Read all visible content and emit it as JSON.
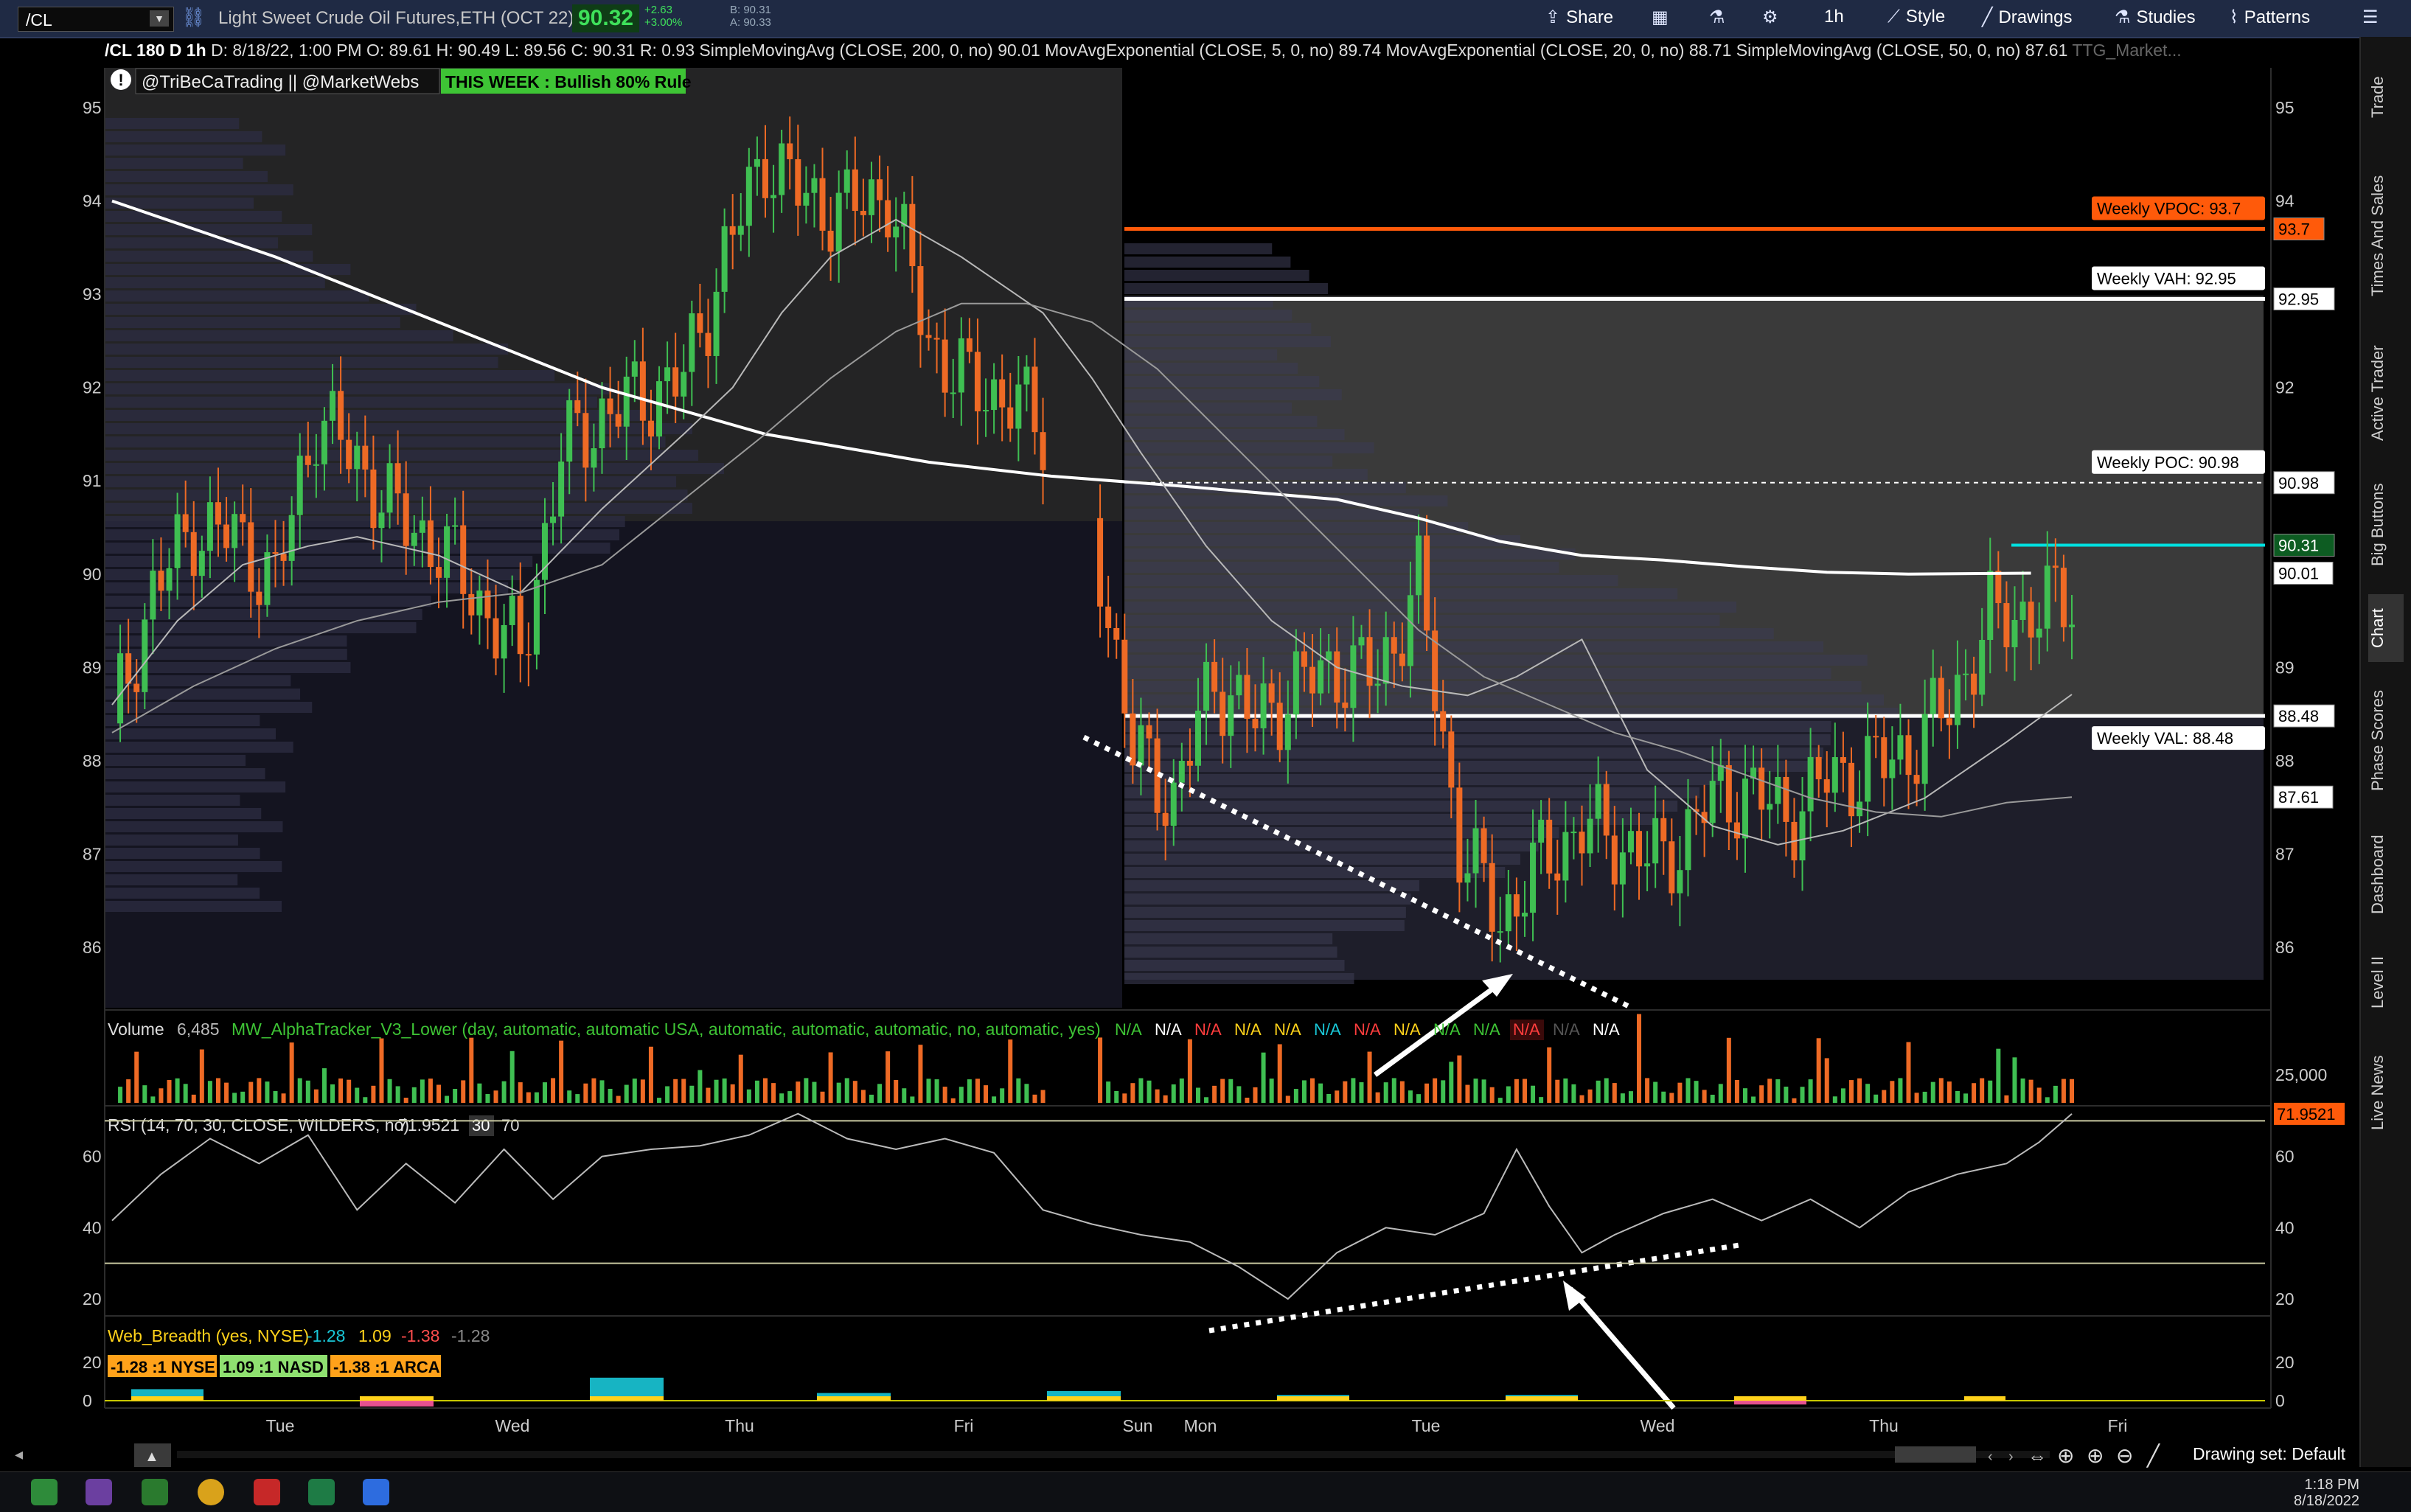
{
  "toolbar": {
    "symbol": "/CL",
    "description": "Light Sweet Crude Oil Futures,ETH (OCT 22)",
    "last": "90.32",
    "net_change": "+2.63",
    "net_change_pct": "+3.00%",
    "bid": "B: 90.31",
    "ask": "A: 90.33",
    "buttons": [
      "Share",
      "1h",
      "Style",
      "Drawings",
      "Studies",
      "Patterns"
    ]
  },
  "status": {
    "chart_title": "/CL 180 D 1h",
    "date": "D: 8/18/22, 1:00 PM",
    "open": "O: 89.61",
    "high": "H: 90.49",
    "low": "L: 89.56",
    "close": "C: 90.31",
    "range": "R: 0.93",
    "studies": [
      {
        "label": "SimpleMovingAvg (CLOSE, 200, 0, no)",
        "value": "90.01"
      },
      {
        "label": "MovAvgExponential (CLOSE, 5, 0, no)",
        "value": "89.74"
      },
      {
        "label": "MovAvgExponential (CLOSE, 20, 0, no)",
        "value": "88.71"
      },
      {
        "label": "SimpleMovingAvg (CLOSE, 50, 0, no)",
        "value": "87.61"
      }
    ],
    "extra": "TTG_Market..."
  },
  "colors": {
    "up": "#3fbf52",
    "down": "#ee6a25",
    "vpoc": "#ff5a0a",
    "value_line": "#ffffff",
    "cyan": "#00e1e1",
    "rsi": "#bbbbbb",
    "alert_bg": "#3ec435"
  },
  "chart_data": [
    {
      "type": "line",
      "panel": "price",
      "ylim": [
        85.4,
        95.5
      ],
      "y_ticks": [
        86,
        87,
        88,
        89,
        90,
        91,
        92,
        93,
        94,
        95
      ],
      "x_tick_labels": [
        "Tue",
        "Wed",
        "Thu",
        "Fri",
        "Sun",
        "Mon",
        "Tue",
        "Wed",
        "Thu",
        "Fri"
      ],
      "watermark": "@TriBeCaTrading || @MarketWebs",
      "alert": "THIS WEEK : Bullish 80% Rule",
      "series": [
        {
          "name": "SimpleMovingAvg (CLOSE, 200, 0, no)",
          "x": [
            0,
            20,
            40,
            60,
            80,
            100,
            115,
            130,
            150,
            160,
            170,
            180,
            190,
            200,
            210,
            220,
            235
          ],
          "y": [
            94.0,
            93.4,
            92.7,
            92.0,
            91.5,
            91.2,
            91.05,
            90.95,
            90.8,
            90.6,
            90.35,
            90.2,
            90.15,
            90.08,
            90.02,
            90.0,
            90.01
          ]
        },
        {
          "name": "MovAvgExponential (CLOSE, 20, 0, no)",
          "x": [
            0,
            8,
            16,
            24,
            30,
            40,
            50,
            60,
            70,
            76,
            82,
            88,
            96,
            104,
            114,
            120,
            126,
            134,
            142,
            150,
            158,
            166,
            172,
            180,
            188,
            196,
            204,
            212,
            222,
            232,
            240
          ],
          "y": [
            88.6,
            89.5,
            90.1,
            90.3,
            90.4,
            90.2,
            89.8,
            90.7,
            91.5,
            92.0,
            92.8,
            93.4,
            93.8,
            93.4,
            92.8,
            92.1,
            91.3,
            90.3,
            89.5,
            89.0,
            88.8,
            88.7,
            88.9,
            89.3,
            87.9,
            87.3,
            87.1,
            87.25,
            87.6,
            88.2,
            88.71
          ]
        },
        {
          "name": "SimpleMovingAvg (CLOSE, 50, 0, no)",
          "x": [
            0,
            10,
            20,
            30,
            40,
            50,
            60,
            70,
            80,
            88,
            96,
            104,
            112,
            120,
            128,
            136,
            144,
            152,
            160,
            168,
            176,
            184,
            192,
            200,
            208,
            216,
            224,
            232,
            240
          ],
          "y": [
            88.3,
            88.8,
            89.2,
            89.5,
            89.7,
            89.8,
            90.1,
            90.8,
            91.5,
            92.1,
            92.6,
            92.9,
            92.9,
            92.7,
            92.2,
            91.5,
            90.8,
            90.1,
            89.4,
            88.9,
            88.6,
            88.3,
            88.1,
            87.85,
            87.6,
            87.45,
            87.4,
            87.55,
            87.61
          ]
        },
        {
          "name": "MovAvgExponential (CLOSE, 5, 0, no)",
          "x": [
            0,
            5,
            10,
            15,
            20,
            25,
            30,
            35,
            40,
            45,
            50,
            55,
            60,
            65,
            70,
            75,
            80,
            85,
            90,
            95,
            100,
            105,
            110,
            115,
            120,
            125,
            130,
            135,
            140,
            145,
            150,
            155,
            160,
            165,
            170,
            175,
            180,
            185,
            190,
            195,
            200,
            205,
            210,
            215,
            220,
            225,
            230,
            235,
            240
          ],
          "y": [
            88.4,
            89.8,
            90.5,
            90.4,
            89.9,
            91.7,
            91.2,
            90.6,
            90.3,
            89.7,
            89.1,
            91.3,
            91.7,
            91.9,
            92.1,
            93.4,
            94.5,
            94.0,
            93.9,
            94.1,
            92.5,
            92.0,
            91.9,
            91.4,
            90.6,
            88.1,
            87.6,
            88.9,
            88.4,
            88.8,
            89.0,
            88.9,
            89.9,
            87.1,
            86.3,
            86.9,
            87.3,
            87.1,
            86.9,
            87.5,
            87.7,
            87.4,
            87.8,
            87.9,
            88.1,
            88.6,
            89.5,
            89.6,
            89.74
          ]
        }
      ],
      "levels": [
        {
          "label": "Weekly VPOC: 93.7",
          "value": 93.7,
          "tag": "93.7",
          "style": "vpoc"
        },
        {
          "label": "Weekly VAH: 92.95",
          "value": 92.95,
          "tag": "92.95",
          "style": "solid"
        },
        {
          "label": "Weekly POC: 90.98",
          "value": 90.98,
          "tag": "90.98",
          "style": "dashed"
        },
        {
          "label": "Weekly VAL: 88.48",
          "value": 88.48,
          "tag": "88.48",
          "style": "solid"
        },
        {
          "label": "",
          "value": 90.31,
          "tag": "90.31",
          "style": "cyan"
        }
      ],
      "right_tags": [
        {
          "value": 90.01,
          "text": "90.01"
        },
        {
          "value": 87.61,
          "text": "87.61"
        }
      ]
    },
    {
      "type": "bar",
      "panel": "volume",
      "title": "Volume",
      "current": "6,485",
      "study": "MW_AlphaTracker_V3_Lower (day, automatic, automatic USA, automatic, automatic, automatic, no, automatic, yes)",
      "na_labels": [
        "N/A",
        "N/A",
        "N/A",
        "N/A",
        "N/A",
        "N/A",
        "N/A",
        "N/A",
        "N/A",
        "N/A",
        "N/A",
        "N/A",
        "N/A"
      ],
      "ylim": [
        0,
        36000
      ],
      "y_ticks": [
        25000
      ],
      "y_tick_labels": [
        "25,000"
      ]
    },
    {
      "type": "line",
      "panel": "rsi",
      "title": "RSI (14, 70, 30, CLOSE, WILDERS, no)",
      "value": "71.9521",
      "overbought": "30",
      "oversold": "70",
      "ylim": [
        15,
        80
      ],
      "y_ticks": [
        20,
        40,
        60
      ],
      "levels": [
        30,
        70
      ],
      "x": [
        0,
        6,
        12,
        18,
        24,
        30,
        36,
        42,
        48,
        54,
        60,
        66,
        72,
        78,
        84,
        90,
        96,
        102,
        108,
        114,
        120,
        126,
        132,
        138,
        144,
        150,
        156,
        162,
        168,
        172,
        176,
        180,
        184,
        190,
        196,
        202,
        208,
        214,
        220,
        226,
        232,
        236,
        240
      ],
      "values": [
        42,
        55,
        65,
        58,
        66,
        45,
        58,
        47,
        62,
        48,
        60,
        62,
        63,
        66,
        72,
        65,
        62,
        65,
        61,
        45,
        41,
        38,
        36,
        29,
        20,
        33,
        40,
        38,
        44,
        62,
        46,
        33,
        38,
        44,
        48,
        42,
        48,
        40,
        50,
        55,
        58,
        64,
        71.95
      ]
    },
    {
      "type": "bar",
      "panel": "breadth",
      "title": "Web_Breadth (yes, NYSE)",
      "values_text": [
        "-1.28",
        "1.09",
        "-1.38",
        "-1.28"
      ],
      "badges": [
        "-1.28 :1 NYSE",
        "1.09 :1 NASD",
        "-1.38 :1 ARCA"
      ],
      "ylim": [
        -5,
        22
      ],
      "y_ticks": [
        0,
        20
      ]
    }
  ],
  "bottom": {
    "drawing_set": "Drawing set: Default"
  },
  "sidebar": {
    "tabs": [
      "Trade",
      "Times And Sales",
      "Active Trader",
      "Big Buttons",
      "Chart",
      "Phase Scores",
      "Dashboard",
      "Level II",
      "Live News"
    ],
    "active": "Chart"
  },
  "taskbar": {
    "time": "1:18 PM",
    "date": "8/18/2022"
  }
}
